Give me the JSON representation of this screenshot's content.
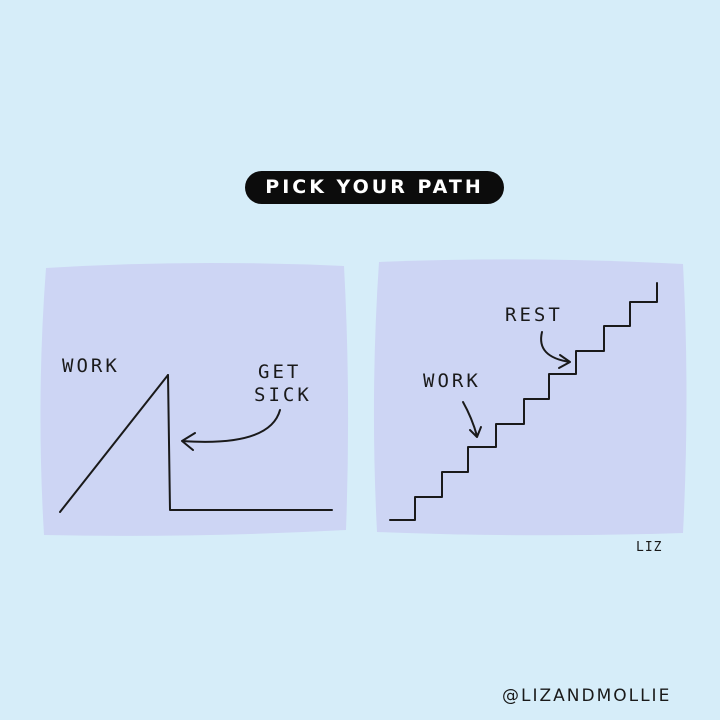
{
  "title": "PICK YOUR PATH",
  "left_panel": {
    "work_label": "WORK",
    "sick_line1": "GET",
    "sick_line2": "SICK"
  },
  "right_panel": {
    "rest_label": "REST",
    "work_label": "WORK"
  },
  "signature": "LIZ",
  "handle": "@LIZANDMOLLIE",
  "colors": {
    "background": "#d6edf9",
    "panel": "#cdd5f4",
    "pill": "#0c0c0c",
    "ink": "#1a1a1a"
  }
}
